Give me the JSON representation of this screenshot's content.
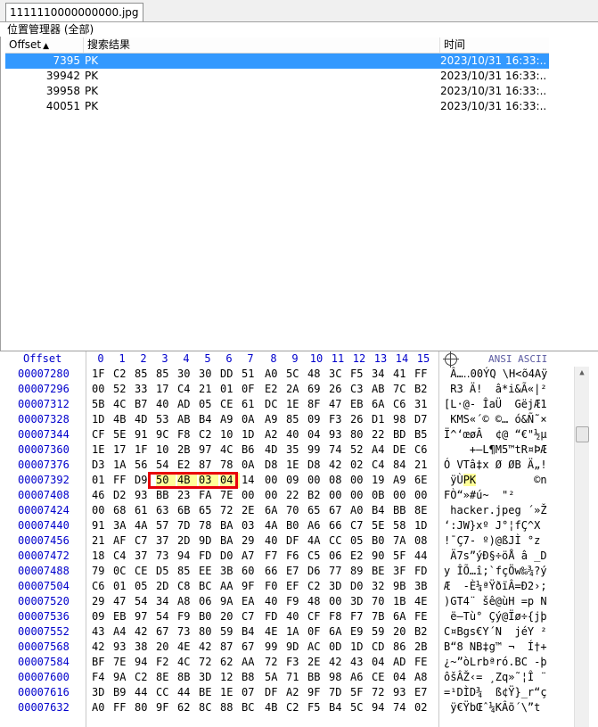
{
  "tab": {
    "label": "1111110000000000.jpg"
  },
  "panel": {
    "title": "位置管理器 (全部)"
  },
  "results": {
    "headers": {
      "offset": "Offset",
      "result": "搜索结果",
      "time": "时间"
    },
    "rows": [
      {
        "offset": "7395",
        "result": "PK",
        "time": "2023/10/31  16:33:..."
      },
      {
        "offset": "39942",
        "result": "PK",
        "time": "2023/10/31  16:33:..."
      },
      {
        "offset": "39958",
        "result": "PK",
        "time": "2023/10/31  16:33:..."
      },
      {
        "offset": "40051",
        "result": "PK",
        "time": "2023/10/31  16:33:..."
      }
    ]
  },
  "hex": {
    "offset_label": "Offset",
    "columns": [
      "0",
      "1",
      "2",
      "3",
      "4",
      "5",
      "6",
      "7",
      "8",
      "9",
      "10",
      "11",
      "12",
      "13",
      "14",
      "15"
    ],
    "ascii_label": "ANSI ASCII",
    "lines": [
      {
        "offset": "00007280",
        "bytes": [
          "1F",
          "C2",
          "85",
          "85",
          "30",
          "30",
          "DD",
          "51",
          "A0",
          "5C",
          "48",
          "3C",
          "F5",
          "34",
          "41",
          "FF"
        ],
        "ascii": " Â…‥00ÝQ \\H<õ4Aÿ"
      },
      {
        "offset": "00007296",
        "bytes": [
          "00",
          "52",
          "33",
          "17",
          "C4",
          "21",
          "01",
          "0F",
          "E2",
          "2A",
          "69",
          "26",
          "C3",
          "AB",
          "7C",
          "B2"
        ],
        "ascii": " R3 Ä!  â*i&Ã«|²"
      },
      {
        "offset": "00007312",
        "bytes": [
          "5B",
          "4C",
          "B7",
          "40",
          "AD",
          "05",
          "CE",
          "61",
          "DC",
          "1E",
          "8F",
          "47",
          "EB",
          "6A",
          "C6",
          "31"
        ],
        "ascii": "[L·@- ÎaÜ  GëjÆ1"
      },
      {
        "offset": "00007328",
        "bytes": [
          "1D",
          "4B",
          "4D",
          "53",
          "AB",
          "B4",
          "A9",
          "0A",
          "A9",
          "85",
          "09",
          "F3",
          "26",
          "D1",
          "98",
          "D7"
        ],
        "ascii": " KMS«´© ©… ó&Ñ˜×"
      },
      {
        "offset": "00007344",
        "bytes": [
          "CF",
          "5E",
          "91",
          "9C",
          "F8",
          "C2",
          "10",
          "1D",
          "A2",
          "40",
          "04",
          "93",
          "80",
          "22",
          "BD",
          "B5"
        ],
        "ascii": "Ï^‘œøÂ  ¢@ “€\"½µ"
      },
      {
        "offset": "00007360",
        "bytes": [
          "1E",
          "17",
          "1F",
          "10",
          "2B",
          "97",
          "4C",
          "B6",
          "4D",
          "35",
          "99",
          "74",
          "52",
          "A4",
          "DE",
          "C6"
        ],
        "ascii": "    +—L¶M5™tR¤ÞÆ"
      },
      {
        "offset": "00007376",
        "bytes": [
          "D3",
          "1A",
          "56",
          "54",
          "E2",
          "87",
          "78",
          "0A",
          "D8",
          "1E",
          "D8",
          "42",
          "02",
          "C4",
          "84",
          "21"
        ],
        "ascii": "Ó VTâ‡x Ø ØB Ä„!"
      },
      {
        "offset": "00007392",
        "bytes": [
          "01",
          "FF",
          "D9",
          "50",
          "4B",
          "03",
          "04",
          "14",
          "00",
          "09",
          "00",
          "08",
          "00",
          "19",
          "A9",
          "6E"
        ],
        "ascii": " ÿÙPK         ©n"
      },
      {
        "offset": "00007408",
        "bytes": [
          "46",
          "D2",
          "93",
          "BB",
          "23",
          "FA",
          "7E",
          "00",
          "00",
          "22",
          "B2",
          "00",
          "00",
          "0B",
          "00",
          "00"
        ],
        "ascii": "FÒ“»#ú~  \"²     "
      },
      {
        "offset": "00007424",
        "bytes": [
          "00",
          "68",
          "61",
          "63",
          "6B",
          "65",
          "72",
          "2E",
          "6A",
          "70",
          "65",
          "67",
          "A0",
          "B4",
          "BB",
          "8E"
        ],
        "ascii": " hacker.jpeg ´»Ž"
      },
      {
        "offset": "00007440",
        "bytes": [
          "91",
          "3A",
          "4A",
          "57",
          "7D",
          "78",
          "BA",
          "03",
          "4A",
          "B0",
          "A6",
          "66",
          "C7",
          "5E",
          "58",
          "1D"
        ],
        "ascii": "‘:JW}xº J°¦fÇ^X "
      },
      {
        "offset": "00007456",
        "bytes": [
          "21",
          "AF",
          "C7",
          "37",
          "2D",
          "9D",
          "BA",
          "29",
          "40",
          "DF",
          "4A",
          "CC",
          "05",
          "B0",
          "7A",
          "08"
        ],
        "ascii": "!¯Ç7- º)@ßJÌ °z "
      },
      {
        "offset": "00007472",
        "bytes": [
          "18",
          "C4",
          "37",
          "73",
          "94",
          "FD",
          "D0",
          "A7",
          "F7",
          "F6",
          "C5",
          "06",
          "E2",
          "90",
          "5F",
          "44"
        ],
        "ascii": " Ä7s”ýÐ§÷öÅ â _D"
      },
      {
        "offset": "00007488",
        "bytes": [
          "79",
          "0C",
          "CE",
          "D5",
          "85",
          "EE",
          "3B",
          "60",
          "66",
          "E7",
          "D6",
          "77",
          "89",
          "BE",
          "3F",
          "FD"
        ],
        "ascii": "y ÎÕ…î;`fçÖw‰¾?ý"
      },
      {
        "offset": "00007504",
        "bytes": [
          "C6",
          "01",
          "05",
          "2D",
          "C8",
          "BC",
          "AA",
          "9F",
          "F0",
          "EF",
          "C2",
          "3D",
          "D0",
          "32",
          "9B",
          "3B"
        ],
        "ascii": "Æ  -È¼ªŸðïÂ=Ð2›;"
      },
      {
        "offset": "00007520",
        "bytes": [
          "29",
          "47",
          "54",
          "34",
          "A8",
          "06",
          "9A",
          "EA",
          "40",
          "F9",
          "48",
          "00",
          "3D",
          "70",
          "1B",
          "4E"
        ],
        "ascii": ")GT4¨ šê@ùH =p N"
      },
      {
        "offset": "00007536",
        "bytes": [
          "09",
          "EB",
          "97",
          "54",
          "F9",
          "B0",
          "20",
          "C7",
          "FD",
          "40",
          "CF",
          "F8",
          "F7",
          "7B",
          "6A",
          "FE"
        ],
        "ascii": " ë—Tù° Çý@Ïø÷{jþ"
      },
      {
        "offset": "00007552",
        "bytes": [
          "43",
          "A4",
          "42",
          "67",
          "73",
          "80",
          "59",
          "B4",
          "4E",
          "1A",
          "0F",
          "6A",
          "E9",
          "59",
          "20",
          "B2"
        ],
        "ascii": "C¤Bgs€Y´N  jéY ²"
      },
      {
        "offset": "00007568",
        "bytes": [
          "42",
          "93",
          "38",
          "20",
          "4E",
          "42",
          "87",
          "67",
          "99",
          "9D",
          "AC",
          "0D",
          "1D",
          "CD",
          "86",
          "2B"
        ],
        "ascii": "B“8 NB‡g™ ¬  Í†+"
      },
      {
        "offset": "00007584",
        "bytes": [
          "BF",
          "7E",
          "94",
          "F2",
          "4C",
          "72",
          "62",
          "AA",
          "72",
          "F3",
          "2E",
          "42",
          "43",
          "04",
          "AD",
          "FE"
        ],
        "ascii": "¿~”òLrbªró.BC -þ"
      },
      {
        "offset": "00007600",
        "bytes": [
          "F4",
          "9A",
          "C2",
          "8E",
          "8B",
          "3D",
          "12",
          "B8",
          "5A",
          "71",
          "BB",
          "98",
          "A6",
          "CE",
          "04",
          "A8"
        ],
        "ascii": "ôšÂŽ‹= ¸Zq»˜¦Î ¨"
      },
      {
        "offset": "00007616",
        "bytes": [
          "3D",
          "B9",
          "44",
          "CC",
          "44",
          "BE",
          "1E",
          "07",
          "DF",
          "A2",
          "9F",
          "7D",
          "5F",
          "72",
          "93",
          "E7"
        ],
        "ascii": "=¹DÌD¾  ß¢Ÿ}_r“ç"
      },
      {
        "offset": "00007632",
        "bytes": [
          "A0",
          "FF",
          "80",
          "9F",
          "62",
          "8C",
          "88",
          "BC",
          "4B",
          "C2",
          "F5",
          "B4",
          "5C",
          "94",
          "74",
          "02"
        ],
        "ascii": " ÿ€ŸbŒˆ¼KÂõ´\\”t "
      }
    ]
  }
}
